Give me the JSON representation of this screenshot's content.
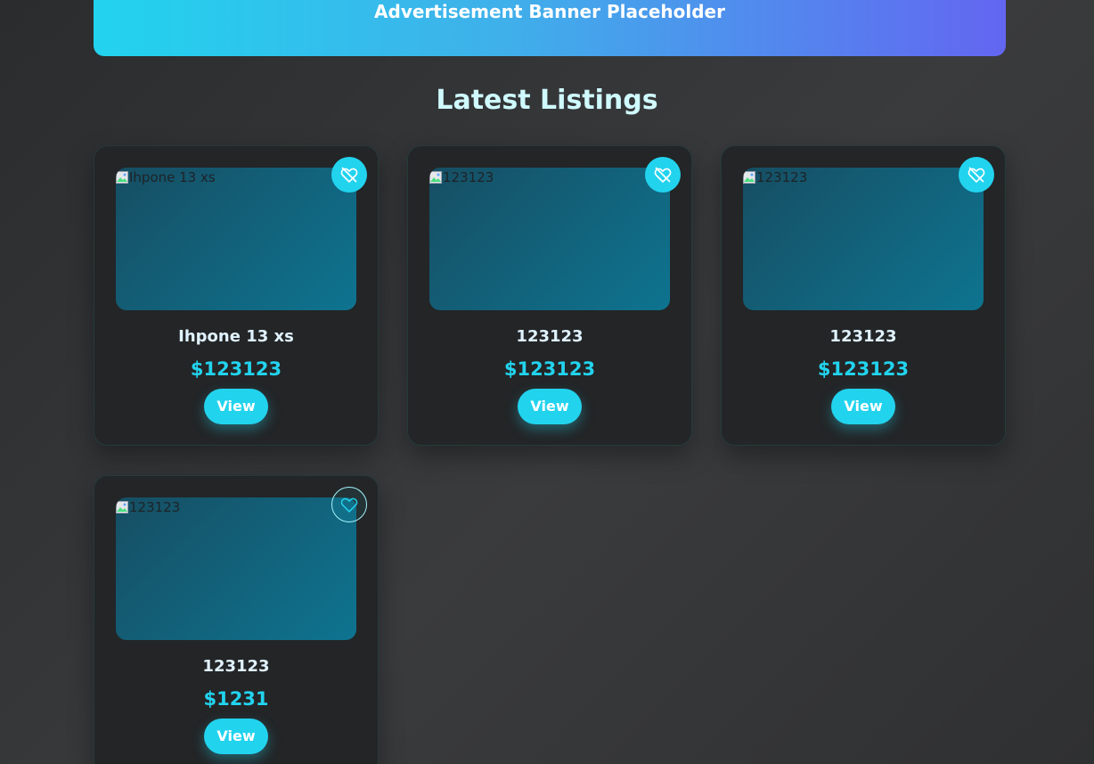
{
  "banner": {
    "text": "Advertisement Banner Placeholder"
  },
  "section": {
    "title": "Latest Listings"
  },
  "listings": [
    {
      "image_alt": "Ihpone 13 xs",
      "title": "Ihpone 13 xs",
      "price": "$123123",
      "view_label": "View",
      "favorited": true
    },
    {
      "image_alt": "123123",
      "title": "123123",
      "price": "$123123",
      "view_label": "View",
      "favorited": true
    },
    {
      "image_alt": "123123",
      "title": "123123",
      "price": "$123123",
      "view_label": "View",
      "favorited": true
    },
    {
      "image_alt": "123123",
      "title": "123123",
      "price": "$1231",
      "view_label": "View",
      "favorited": false
    }
  ],
  "icons": {
    "favorite_active": "heart-off-icon",
    "favorite_inactive": "heart-icon",
    "broken_image": "broken-image-icon"
  },
  "colors": {
    "accent": "#22d3ee",
    "banner_gradient_start": "#22d3ee",
    "banner_gradient_end": "#6366f1",
    "card_background": "#232527",
    "title_color": "#cffafe"
  }
}
